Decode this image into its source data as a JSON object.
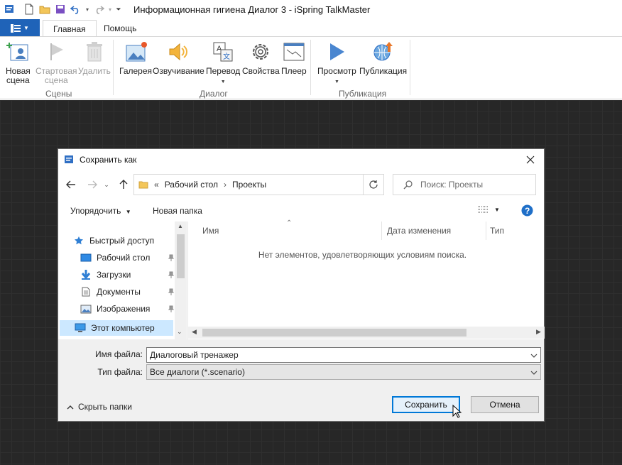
{
  "window": {
    "title": "Информационная гигиена Диалог 3 - iSpring TalkMaster"
  },
  "ribbon_tabs": {
    "home": "Главная",
    "help": "Помощь"
  },
  "ribbon": {
    "groups": {
      "scenes": "Сцены",
      "dialog": "Диалог",
      "publish": "Публикация"
    },
    "buttons": {
      "new_scene_1": "Новая",
      "new_scene_2": "сцена",
      "start_scene_1": "Стартовая",
      "start_scene_2": "сцена",
      "delete": "Удалить",
      "gallery": "Галерея",
      "voiceover": "Озвучивание",
      "translate": "Перевод",
      "properties": "Свойства",
      "player": "Плеер",
      "preview": "Просмотр",
      "publish": "Публикация"
    }
  },
  "dialog": {
    "title": "Сохранить как",
    "address": {
      "overflow": "«",
      "crumbs": [
        "Рабочий стол",
        "Проекты"
      ]
    },
    "search_placeholder": "Поиск: Проекты",
    "commands": {
      "organize": "Упорядочить",
      "new_folder": "Новая папка"
    },
    "nav": {
      "quick_access": "Быстрый доступ",
      "items": [
        {
          "label": "Рабочий стол",
          "icon": "desktop-icon"
        },
        {
          "label": "Загрузки",
          "icon": "download-icon"
        },
        {
          "label": "Документы",
          "icon": "documents-icon"
        },
        {
          "label": "Изображения",
          "icon": "pictures-icon"
        }
      ],
      "this_pc": "Этот компьютер"
    },
    "columns": {
      "name": "Имя",
      "date": "Дата изменения",
      "type": "Тип"
    },
    "empty_message": "Нет элементов, удовлетворяющих условиям поиска.",
    "fields": {
      "filename_label": "Имя файла:",
      "filename_value": "Диалоговый тренажер",
      "filetype_label": "Тип файла:",
      "filetype_value": "Все диалоги (*.scenario)"
    },
    "hide_folders": "Скрыть папки",
    "save": "Сохранить",
    "cancel": "Отмена"
  },
  "colors": {
    "accent": "#0078d7",
    "file_tab": "#1f63b8",
    "workspace": "#272727"
  }
}
